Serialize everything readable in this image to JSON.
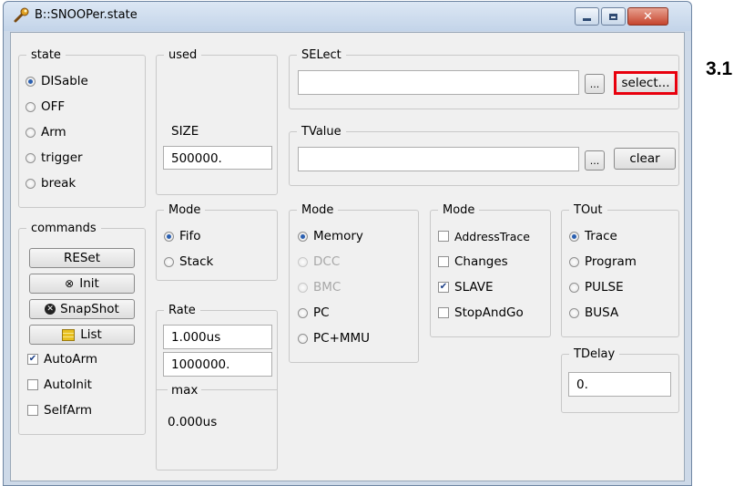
{
  "window": {
    "title": "B::SNOOPer.state"
  },
  "annotation": {
    "callout": "3.1"
  },
  "state": {
    "legend": "state",
    "options": [
      "DISable",
      "OFF",
      "Arm",
      "trigger",
      "break"
    ],
    "selected": "DISable"
  },
  "used": {
    "legend": "used"
  },
  "size": {
    "legend": "SIZE",
    "value": "500000."
  },
  "select": {
    "legend": "SELect",
    "value": "",
    "browse_label": "...",
    "select_label": "select..."
  },
  "tvalue": {
    "legend": "TValue",
    "value": "",
    "browse_label": "...",
    "clear_label": "clear"
  },
  "commands": {
    "legend": "commands",
    "reset": "RESet",
    "init": "Init",
    "snapshot": "SnapShot",
    "list": "List",
    "autoarm": "AutoArm",
    "autoinit": "AutoInit",
    "selfarm": "SelfArm",
    "autoarm_checked": true,
    "autoinit_checked": false,
    "selfarm_checked": false
  },
  "mode1": {
    "legend": "Mode",
    "options": [
      "Fifo",
      "Stack"
    ],
    "selected": "Fifo"
  },
  "rate": {
    "legend": "Rate",
    "value1": "1.000us",
    "value2": "1000000.",
    "max_legend": "max",
    "max_value": "0.000us"
  },
  "mode2": {
    "legend": "Mode",
    "options": [
      "Memory",
      "DCC",
      "BMC",
      "PC",
      "PC+MMU"
    ],
    "selected": "Memory",
    "disabled": [
      "DCC",
      "BMC"
    ]
  },
  "mode3": {
    "legend": "Mode",
    "options": [
      "AddressTrace",
      "Changes",
      "SLAVE",
      "StopAndGo"
    ],
    "checked": [
      "SLAVE"
    ]
  },
  "tout": {
    "legend": "TOut",
    "options": [
      "Trace",
      "Program",
      "PULSE",
      "BUSA"
    ],
    "selected": "Trace"
  },
  "tdelay": {
    "legend": "TDelay",
    "value": "0."
  },
  "colors": {
    "highlight": "#e8000d",
    "titlebar": "#c3d4e9",
    "panel": "#f0f0f0"
  }
}
